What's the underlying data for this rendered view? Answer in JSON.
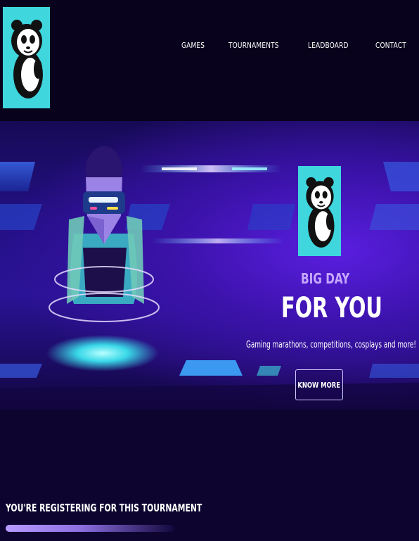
{
  "header": {
    "logo_icon": "panda-icon",
    "nav": [
      {
        "label": "GAMES"
      },
      {
        "label": "TOURNAMENTS"
      },
      {
        "label": "LEADBOARD"
      },
      {
        "label": "CONTACT"
      }
    ]
  },
  "hero": {
    "logo_icon": "panda-icon",
    "kicker": "BIG DAY",
    "headline": "FOR YOU",
    "tagline": "Gaming marathons, competitions, cosplays and more!",
    "cta_label": "KNOW MORE",
    "illustration": "vr-gamer-illustration"
  },
  "register": {
    "title": "YOU'RE REGISTERING FOR THIS TOURNAMENT"
  },
  "colors": {
    "logo_bg": "#3fd6de",
    "header_bg": "#08021c",
    "accent_purple": "#c6a8ff",
    "hero_glow": "#5a1ee0"
  }
}
